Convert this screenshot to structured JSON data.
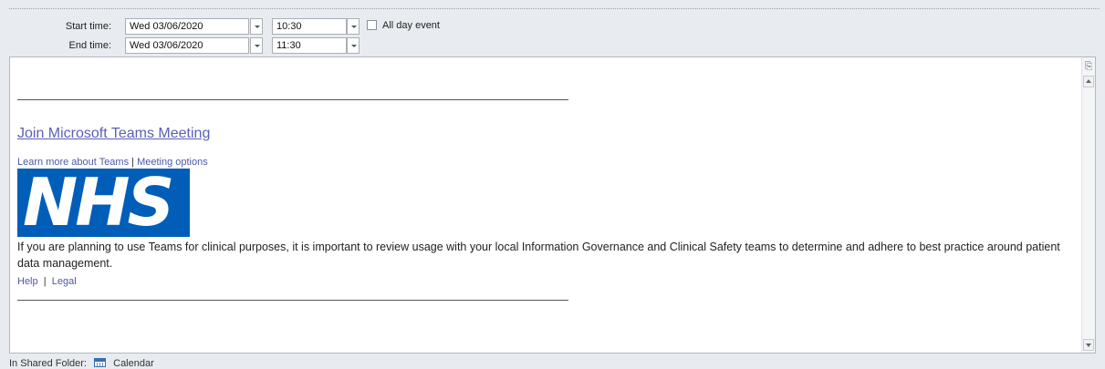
{
  "schedule": {
    "start_label": "Start time:",
    "start_date": "Wed 03/06/2020",
    "start_time": "10:30",
    "end_label": "End time:",
    "end_date": "Wed 03/06/2020",
    "end_time": "11:30",
    "all_day_label": "All day event",
    "all_day_checked": false
  },
  "body": {
    "join_link": "Join Microsoft Teams Meeting",
    "learn_more": "Learn more about Teams",
    "separator": "|",
    "meeting_options": "Meeting options",
    "logo_text": "NHS",
    "logo_color": "#005eb8",
    "paragraph": "If you are planning to use Teams for clinical purposes, it is important to review usage with your local Information Governance and Clinical Safety teams to determine and adhere to best practice around patient data management.",
    "help": "Help",
    "legal": "Legal"
  },
  "status": {
    "folder_label": "In Shared Folder:",
    "folder_name": "Calendar"
  },
  "colors": {
    "link": "#5b5fb8",
    "background": "#e8ebef"
  }
}
